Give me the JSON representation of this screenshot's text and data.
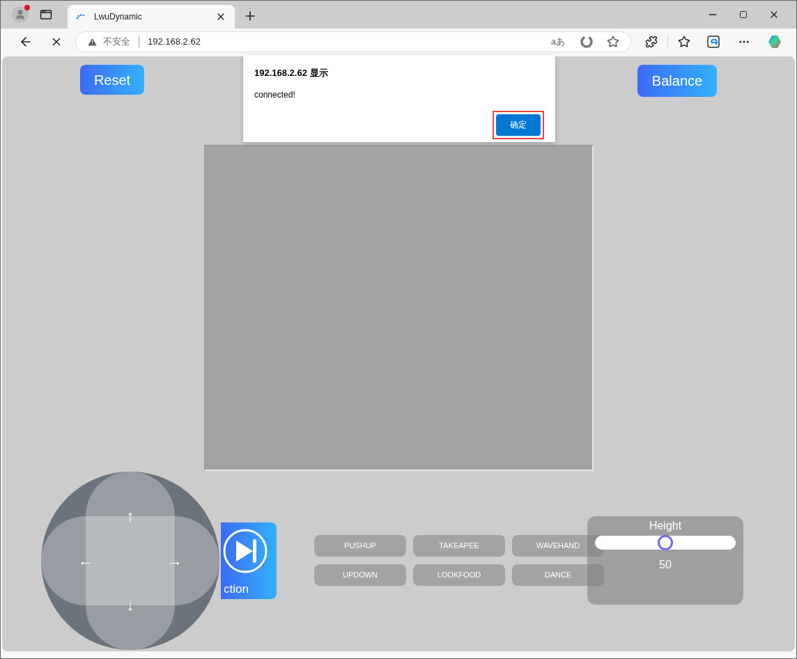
{
  "browser": {
    "tab": {
      "title": "LwuDynamic",
      "selected": true
    },
    "address": {
      "security": "不安全",
      "url": "192.168.2.62",
      "read_aloud": "aあ"
    }
  },
  "page": {
    "top_buttons": [
      {
        "label": "Reset"
      },
      {
        "label": "Balance"
      }
    ],
    "action_button": {
      "label": "ction"
    },
    "joystick": {
      "up": "↑",
      "left": "←",
      "right": "→",
      "down": "↓"
    },
    "commands": [
      {
        "label": "PUSHUP"
      },
      {
        "label": "TAKEAPEE"
      },
      {
        "label": "WAVEHAND"
      },
      {
        "label": "UPDOWN"
      },
      {
        "label": "LOOKFOOD"
      },
      {
        "label": "DANCE"
      }
    ],
    "height": {
      "label": "Height",
      "level": 0.5,
      "reading": "50"
    }
  },
  "dialog": {
    "title": "192.168.2.62 显示",
    "message": "connected!",
    "ok": "确定",
    "highlighted": true
  }
}
